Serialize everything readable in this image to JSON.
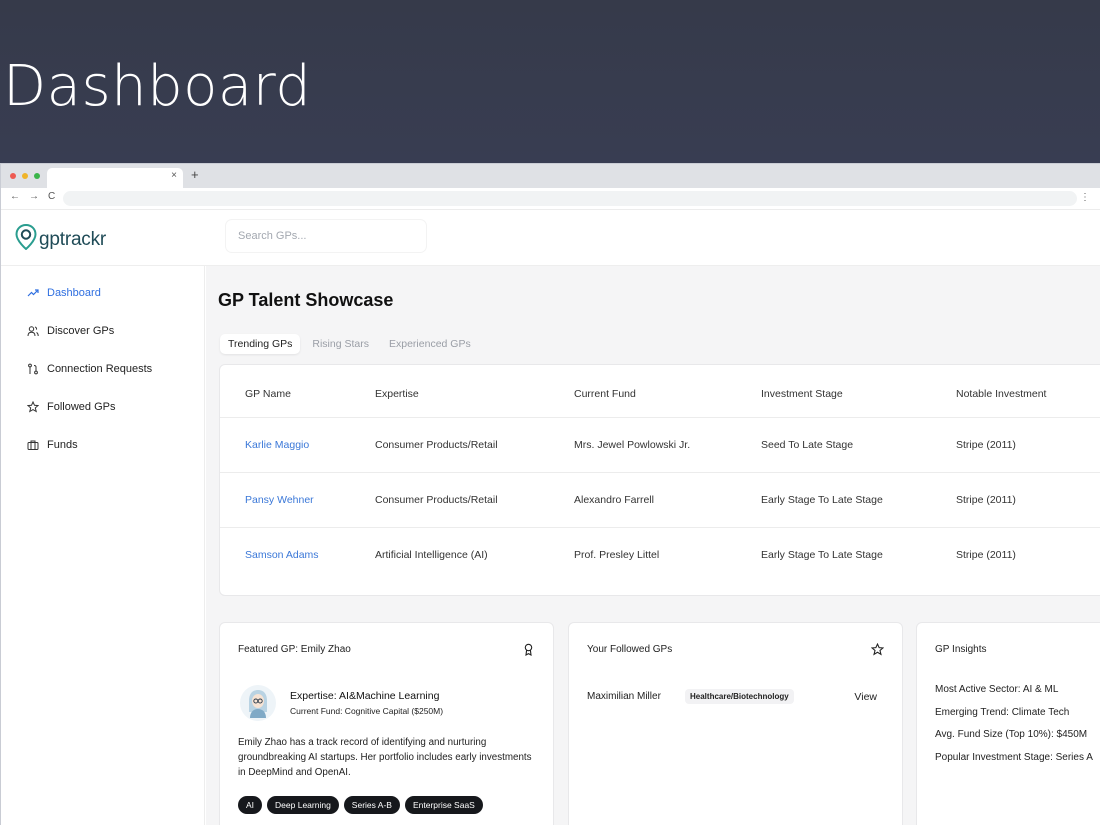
{
  "slide": {
    "title": "Dashboard"
  },
  "browser": {
    "tab_close": "×",
    "new_tab": "+",
    "back": "←",
    "forward": "→",
    "reload": "C",
    "menu": "⋮"
  },
  "app": {
    "logo_text": "gptrackr",
    "search_placeholder": "Search GPs..."
  },
  "sidebar": {
    "items": [
      {
        "label": "Dashboard",
        "icon": "trending-icon",
        "active": true
      },
      {
        "label": "Discover GPs",
        "icon": "users-icon"
      },
      {
        "label": "Connection Requests",
        "icon": "git-pull-icon"
      },
      {
        "label": "Followed GPs",
        "icon": "star-icon"
      },
      {
        "label": "Funds",
        "icon": "briefcase-icon"
      }
    ]
  },
  "main": {
    "title": "GP Talent Showcase",
    "tabs": [
      "Trending GPs",
      "Rising Stars",
      "Experienced GPs"
    ],
    "table": {
      "headers": [
        "GP Name",
        "Expertise",
        "Current Fund",
        "Investment Stage",
        "Notable Investment"
      ],
      "rows": [
        [
          "Karlie Maggio",
          "Consumer Products/Retail",
          "Mrs. Jewel Powlowski Jr.",
          "Seed To Late Stage",
          "Stripe (2011)"
        ],
        [
          "Pansy Wehner",
          "Consumer Products/Retail",
          "Alexandro Farrell",
          "Early Stage To Late Stage",
          "Stripe (2011)"
        ],
        [
          "Samson Adams",
          "Artificial Intelligence (AI)",
          "Prof. Presley Littel",
          "Early Stage To Late Stage",
          "Stripe (2011)"
        ]
      ]
    }
  },
  "featured": {
    "title": "Featured GP: Emily Zhao",
    "expertise": "Expertise: AI&Machine Learning",
    "current_fund": "Current Fund: Cognitive Capital ($250M)",
    "bio": "Emily Zhao has a track record of identifying and nurturing groundbreaking AI startups. Her portfolio includes early investments in DeepMind and OpenAI.",
    "tags": [
      "AI",
      "Deep Learning",
      "Series A-B",
      "Enterprise SaaS"
    ]
  },
  "followed": {
    "title": "Your Followed GPs",
    "items": [
      {
        "name": "Maximilian Miller",
        "tag": "Healthcare/Biotechnology",
        "action": "View"
      }
    ]
  },
  "insights": {
    "title": "GP Insights",
    "items": [
      "Most Active Sector: AI & ML",
      "Emerging Trend: Climate Tech",
      "Avg. Fund Size (Top 10%): $450M",
      "Popular Investment Stage: Series A"
    ]
  },
  "colors": {
    "accent": "#2f6fe0",
    "link": "#3b78d8",
    "logo": "#1f4b57",
    "tag_bg": "#16181c"
  }
}
